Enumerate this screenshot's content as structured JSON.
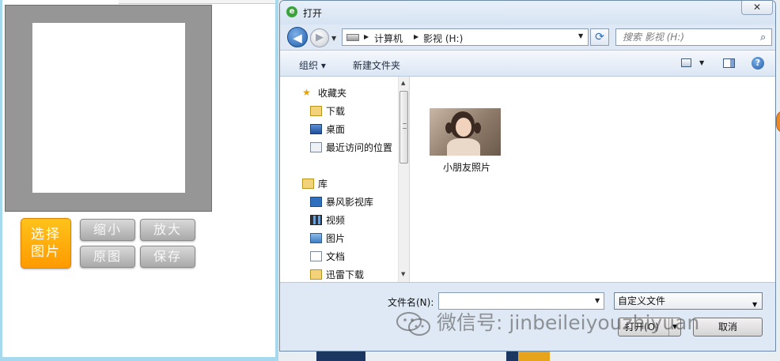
{
  "left_app": {
    "buttons": {
      "choose_line1": "选择",
      "choose_line2": "图片",
      "shrink": "缩小",
      "enlarge": "放大",
      "original": "原图",
      "save": "保存"
    }
  },
  "dialog": {
    "title": "打开",
    "close_glyph": "✕",
    "address": {
      "segments": [
        "计算机",
        "影视 (H:)"
      ]
    },
    "search_placeholder": "搜索 影视 (H:)",
    "toolbar": {
      "organize": "组织 ▾",
      "new_folder": "新建文件夹"
    },
    "nav": [
      {
        "label": "收藏夹",
        "icon": "star-icon"
      },
      {
        "label": "下载",
        "icon": "download-folder-icon"
      },
      {
        "label": "桌面",
        "icon": "desktop-icon"
      },
      {
        "label": "最近访问的位置",
        "icon": "recent-places-icon"
      },
      {
        "label": "库",
        "icon": "library-icon"
      },
      {
        "label": "暴风影视库",
        "icon": "video-library-icon"
      },
      {
        "label": "视频",
        "icon": "video-icon"
      },
      {
        "label": "图片",
        "icon": "pictures-icon"
      },
      {
        "label": "文档",
        "icon": "documents-icon"
      },
      {
        "label": "迅雷下载",
        "icon": "thunder-download-icon"
      }
    ],
    "files": [
      {
        "name": "小朋友照片",
        "type": "image-thumbnail"
      }
    ],
    "filename_label": "文件名(N):",
    "filename_value": "",
    "filter_value": "自定义文件",
    "open_button": "打开(O)",
    "cancel_button": "取消"
  },
  "watermark": {
    "text": "微信号: jinbeileiyouzhiyuan"
  },
  "colors": {
    "choose_button": "#ff9a00",
    "gray_button": "#b3b3b3",
    "canvas_frame": "#969696",
    "dialog_chrome": "#dfe9f5",
    "back_button": "#1f5ca8"
  }
}
